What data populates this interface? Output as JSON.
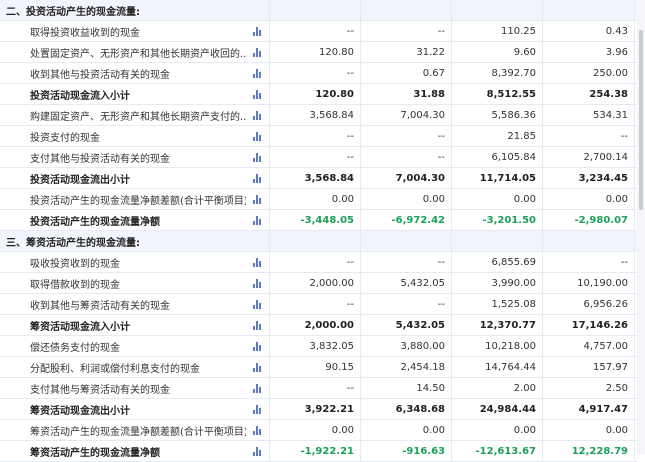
{
  "rows": [
    {
      "label": "二、投资活动产生的现金流量:",
      "type": "section",
      "values": [
        "",
        "",
        "",
        ""
      ]
    },
    {
      "label": "取得投资收益收到的现金",
      "type": "normal",
      "values": [
        "--",
        "--",
        "110.25",
        "0.43"
      ]
    },
    {
      "label": "处置固定资产、无形资产和其他长期资产收回的...",
      "type": "normal",
      "values": [
        "120.80",
        "31.22",
        "9.60",
        "3.96"
      ]
    },
    {
      "label": "收到其他与投资活动有关的现金",
      "type": "normal",
      "values": [
        "--",
        "0.67",
        "8,392.70",
        "250.00"
      ]
    },
    {
      "label": "投资活动现金流入小计",
      "type": "bold",
      "values": [
        "120.80",
        "31.88",
        "8,512.55",
        "254.38"
      ]
    },
    {
      "label": "购建固定资产、无形资产和其他长期资产支付的...",
      "type": "normal",
      "values": [
        "3,568.84",
        "7,004.30",
        "5,586.36",
        "534.31"
      ]
    },
    {
      "label": "投资支付的现金",
      "type": "normal",
      "values": [
        "--",
        "--",
        "21.85",
        "--"
      ]
    },
    {
      "label": "支付其他与投资活动有关的现金",
      "type": "normal",
      "values": [
        "--",
        "--",
        "6,105.84",
        "2,700.14"
      ]
    },
    {
      "label": "投资活动现金流出小计",
      "type": "bold",
      "values": [
        "3,568.84",
        "7,004.30",
        "11,714.05",
        "3,234.45"
      ]
    },
    {
      "label": "投资活动产生的现金流量净额差额(合计平衡项目)",
      "type": "normal",
      "values": [
        "0.00",
        "0.00",
        "0.00",
        "0.00"
      ]
    },
    {
      "label": "投资活动产生的现金流量净额",
      "type": "net",
      "values": [
        "-3,448.05",
        "-6,972.42",
        "-3,201.50",
        "-2,980.07"
      ]
    },
    {
      "label": "三、筹资活动产生的现金流量:",
      "type": "section",
      "values": [
        "",
        "",
        "",
        ""
      ]
    },
    {
      "label": "吸收投资收到的现金",
      "type": "normal",
      "values": [
        "--",
        "--",
        "6,855.69",
        "--"
      ]
    },
    {
      "label": "取得借款收到的现金",
      "type": "normal",
      "values": [
        "2,000.00",
        "5,432.05",
        "3,990.00",
        "10,190.00"
      ]
    },
    {
      "label": "收到其他与筹资活动有关的现金",
      "type": "normal",
      "values": [
        "--",
        "--",
        "1,525.08",
        "6,956.26"
      ]
    },
    {
      "label": "筹资活动现金流入小计",
      "type": "bold",
      "values": [
        "2,000.00",
        "5,432.05",
        "12,370.77",
        "17,146.26"
      ]
    },
    {
      "label": "偿还债务支付的现金",
      "type": "normal",
      "values": [
        "3,832.05",
        "3,880.00",
        "10,218.00",
        "4,757.00"
      ]
    },
    {
      "label": "分配股利、利润或偿付利息支付的现金",
      "type": "normal",
      "values": [
        "90.15",
        "2,454.18",
        "14,764.44",
        "157.97"
      ]
    },
    {
      "label": "支付其他与筹资活动有关的现金",
      "type": "normal",
      "values": [
        "--",
        "14.50",
        "2.00",
        "2.50"
      ]
    },
    {
      "label": "筹资活动现金流出小计",
      "type": "bold",
      "values": [
        "3,922.21",
        "6,348.68",
        "24,984.44",
        "4,917.47"
      ]
    },
    {
      "label": "筹资活动产生的现金流量净额差额(合计平衡项目)",
      "type": "normal",
      "values": [
        "0.00",
        "0.00",
        "0.00",
        "0.00"
      ]
    },
    {
      "label": "筹资活动产生的现金流量净额",
      "type": "net",
      "values": [
        "-1,922.21",
        "-916.63",
        "-12,613.67",
        "12,228.79"
      ]
    }
  ],
  "icon": "bar-chart-icon",
  "colors": {
    "positive": "#1aa05a",
    "header_bg": "#f2f5fb",
    "border": "#e6eaf2",
    "icon": "#5b7cbf"
  }
}
